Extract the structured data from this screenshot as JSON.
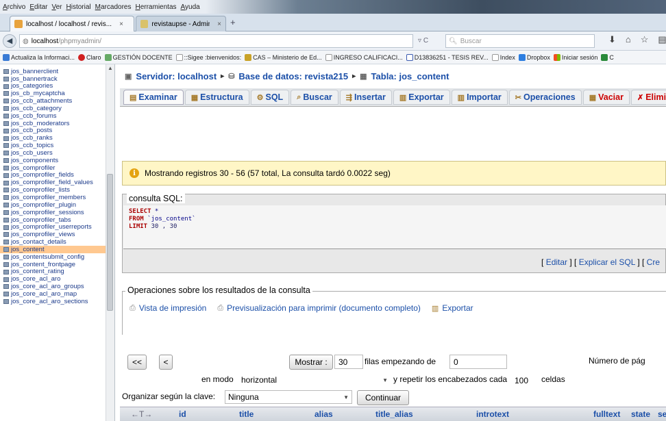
{
  "browser": {
    "menu": [
      "Archivo",
      "Editar",
      "Ver",
      "Historial",
      "Marcadores",
      "Herramientas",
      "Ayuda"
    ],
    "tabs": [
      {
        "label": "localhost / localhost / revis...",
        "close": "×"
      },
      {
        "label": "revistaupse - Administración",
        "close": "×"
      }
    ],
    "new_tab": "+",
    "url_host": "localhost",
    "url_path": "/phpmyadmin/",
    "search_placeholder": "Buscar",
    "bookmarks": [
      "Actualiza la Informaci...",
      "Claro",
      "GESTIÓN DOCENTE",
      "::Sigee :bienvenidos:",
      "CAS – Ministerio de Ed...",
      "INGRESO CALIFICACI...",
      "D13836251 - TESIS REV...",
      "Index",
      "Dropbox",
      "Iniciar sesión",
      "C"
    ]
  },
  "sidebar": {
    "items": [
      "jos_bannerclient",
      "jos_bannertrack",
      "jos_categories",
      "jos_cb_mycaptcha",
      "jos_ccb_attachments",
      "jos_ccb_category",
      "jos_ccb_forums",
      "jos_ccb_moderators",
      "jos_ccb_posts",
      "jos_ccb_ranks",
      "jos_ccb_topics",
      "jos_ccb_users",
      "jos_components",
      "jos_comprofiler",
      "jos_comprofiler_fields",
      "jos_comprofiler_field_values",
      "jos_comprofiler_lists",
      "jos_comprofiler_members",
      "jos_comprofiler_plugin",
      "jos_comprofiler_sessions",
      "jos_comprofiler_tabs",
      "jos_comprofiler_userreports",
      "jos_comprofiler_views",
      "jos_contact_details",
      "jos_content",
      "jos_contentsubmit_config",
      "jos_content_frontpage",
      "jos_content_rating",
      "jos_core_acl_aro",
      "jos_core_acl_aro_groups",
      "jos_core_acl_aro_map",
      "jos_core_acl_aro_sections"
    ],
    "selected": "jos_content"
  },
  "breadcrumb": {
    "server": "Servidor: localhost",
    "database": "Base de datos: revista215",
    "table": "Tabla: jos_content"
  },
  "tabs": [
    "Examinar",
    "Estructura",
    "SQL",
    "Buscar",
    "Insertar",
    "Exportar",
    "Importar",
    "Operaciones",
    "Vaciar",
    "Elimin"
  ],
  "notice": "Mostrando registros 30 - 56 (57 total, La consulta tardó 0.0022 seg)",
  "sql": {
    "legend": "consulta SQL:",
    "line1_kw": "SELECT",
    "line1_rest": " *",
    "line2_kw": "FROM",
    "line2_rest": " `jos_content`",
    "line3_kw": "LIMIT",
    "line3_rest": " 30 , 30",
    "links_open": "[ ",
    "edit": "Editar",
    "links_mid1": " ] [ ",
    "explain": "Explicar el SQL",
    "links_mid2": " ] [ ",
    "create": "Cre"
  },
  "ops": {
    "legend": "Operaciones sobre los resultados de la consulta",
    "print_view": "Vista de impresión",
    "print_full": "Previsualización para imprimir (documento completo)",
    "export": "Exportar"
  },
  "nav": {
    "first": "<<",
    "prev": "<",
    "show_button": "Mostrar :",
    "rows_value": "30",
    "rows_label": "filas empezando de",
    "start_value": "0",
    "page_label": "Número de pág",
    "mode_label": "en modo",
    "mode_value": "horizontal",
    "repeat_label": "y repetir los encabezados cada",
    "repeat_value": "100",
    "cells_label": "celdas",
    "sort_label": "Organizar según la clave:",
    "sort_value": "Ninguna",
    "continue_button": "Continuar"
  },
  "table": {
    "arrows": "←T→",
    "columns": [
      "id",
      "title",
      "alias",
      "title_alias",
      "introtext",
      "fulltext",
      "state",
      "se"
    ]
  }
}
